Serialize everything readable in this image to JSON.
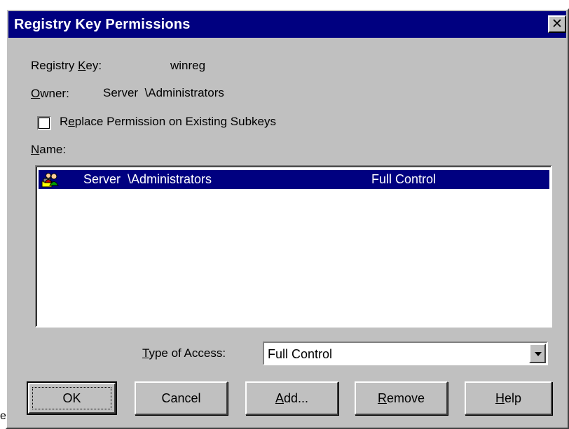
{
  "window": {
    "title": "Registry Key Permissions",
    "close_glyph": "✕"
  },
  "registry_key": {
    "label_pre": "Registry ",
    "label_accel": "K",
    "label_post": "ey:",
    "value": "winreg"
  },
  "owner": {
    "label_accel": "O",
    "label_post": "wner:",
    "value": "Server  \\Administrators"
  },
  "replace_checkbox": {
    "label_pre": "R",
    "label_accel": "e",
    "label_post": "place Permission on Existing Subkeys",
    "checked": false
  },
  "name_list": {
    "label_accel": "N",
    "label_post": "ame:",
    "rows": [
      {
        "icon": "user-group-icon",
        "name": "Server  \\Administrators",
        "access": "Full Control",
        "selected": true
      }
    ]
  },
  "type_of_access": {
    "label_accel": "T",
    "label_post": "ype of Access:",
    "selected_value": "Full Control"
  },
  "buttons": {
    "ok": "OK",
    "cancel": "Cancel",
    "add_accel": "A",
    "add_post": "dd...",
    "remove_accel": "R",
    "remove_post": "emove",
    "help_accel": "H",
    "help_post": "elp"
  },
  "edge_fragment": "e",
  "colors": {
    "title_bar": "#000080",
    "dialog_face": "#c0c0c0",
    "selection": "#000080"
  }
}
